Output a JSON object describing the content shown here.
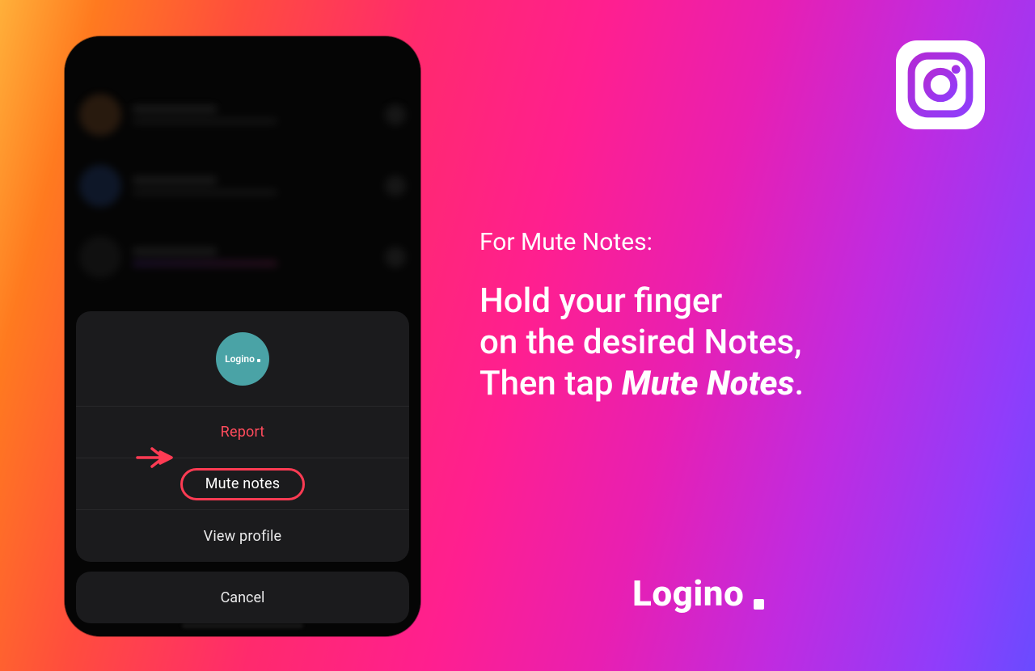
{
  "badge": {
    "name": "instagram-icon"
  },
  "phone": {
    "avatar_label": "Logino",
    "sheet": {
      "report_label": "Report",
      "mute_label": "Mute notes",
      "view_label": "View profile",
      "cancel_label": "Cancel"
    }
  },
  "copy": {
    "lead": "For Mute Notes:",
    "line1": "Hold your finger",
    "line2": "on the desired Notes,",
    "line3_prefix": "Then tap ",
    "line3_em": "Mute Notes",
    "line3_suffix": "."
  },
  "brand": {
    "name": "Logino"
  }
}
